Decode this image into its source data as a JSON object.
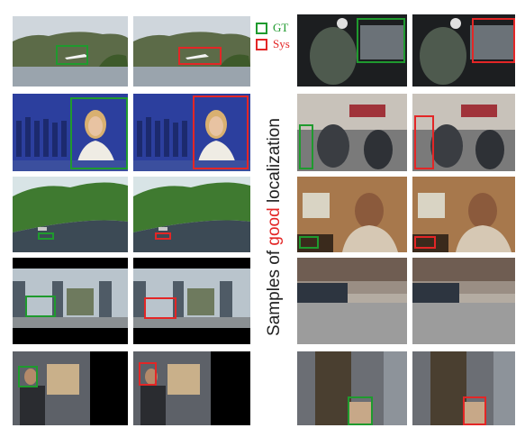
{
  "legend": {
    "gt": {
      "label": "GT",
      "color": "#1f9a2e"
    },
    "sys": {
      "label": "Sys",
      "color": "#e32626"
    }
  },
  "caption": {
    "prefix": "Samples of ",
    "highlight": "good",
    "suffix": " localization"
  }
}
